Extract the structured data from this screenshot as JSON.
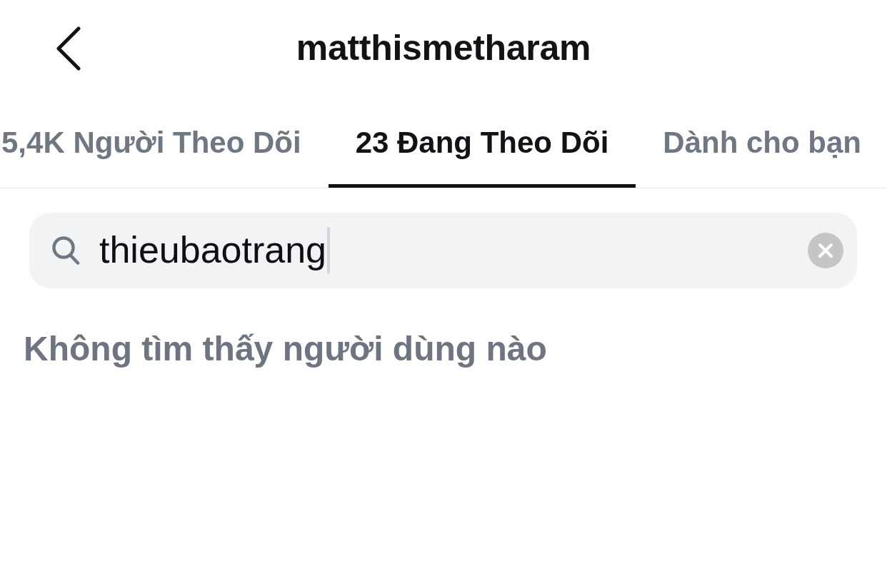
{
  "header": {
    "title": "matthismetharam"
  },
  "tabs": [
    {
      "label": "5,4K Người Theo Dõi",
      "selected": false
    },
    {
      "label": "23 Đang Theo Dõi",
      "selected": true
    },
    {
      "label": "Dành cho bạn",
      "selected": false
    }
  ],
  "search": {
    "value": "thieubaotrang",
    "focused": true
  },
  "empty_message": "Không tìm thấy người dùng nào"
}
